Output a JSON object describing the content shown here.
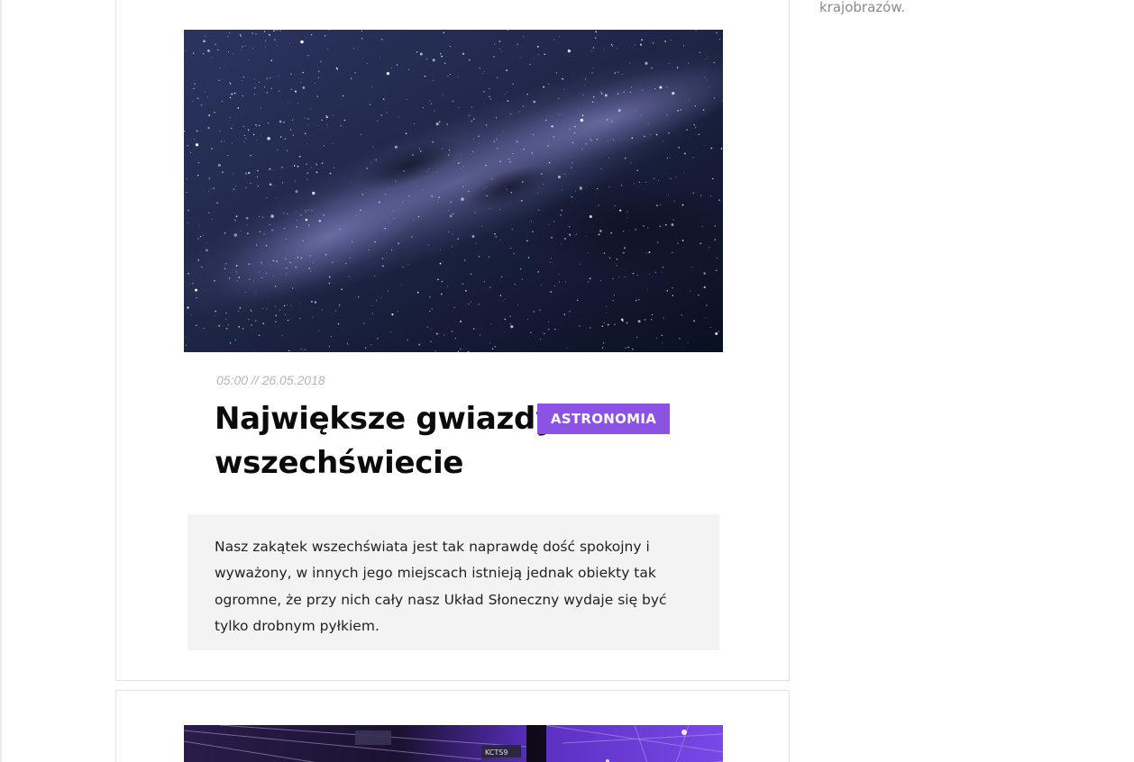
{
  "sidebar": {
    "text_fragment": "krajobrazów."
  },
  "posts": [
    {
      "image_alt": "Milky way starfield",
      "meta": "05:00 // 26.05.2018",
      "title": "Największe gwiazdy we wszechświecie",
      "category": "ASTRONOMIA",
      "excerpt": "Nasz zakątek wszechświata jest tak naprawdę dość spokojny i wyważony, w innych jego miejscach istnieją jednak obiekty tak ogromne, że przy nich cały nasz Układ Słoneczny wydaje się być tylko drobnym pyłkiem."
    },
    {
      "image_alt": "Stadium with purple lights",
      "sign_text": "KCTS9"
    }
  ],
  "colors": {
    "accent": "#8b52e3",
    "excerpt_bg": "#f3f3f3",
    "meta": "#b5b5b5"
  }
}
